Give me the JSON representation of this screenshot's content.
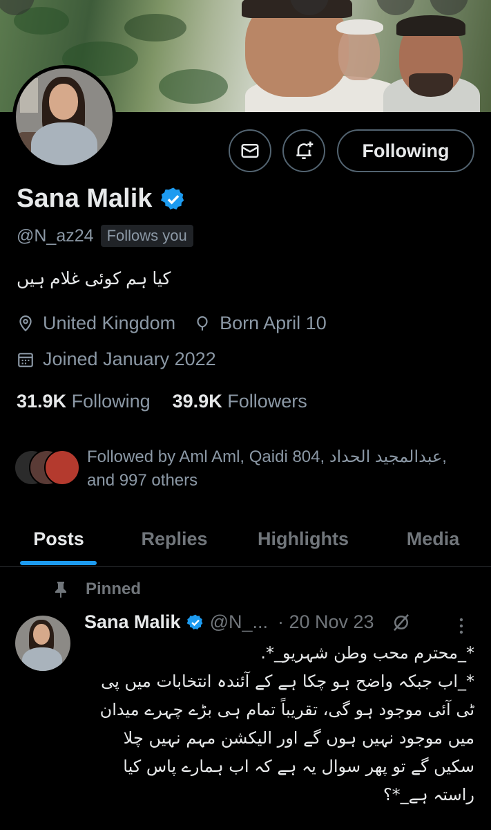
{
  "profile": {
    "name": "Sana Malik",
    "handle": "@N_az24",
    "follows_you": "Follows you",
    "bio": "کیا ہم کوئی غلام ہیں",
    "location": "United Kingdom",
    "born": "Born April 10",
    "joined": "Joined January 2022",
    "following_count": "31.9K",
    "following_label": "Following",
    "followers_count": "39.9K",
    "followers_label": "Followers",
    "followed_by_line1": "Followed by Aml Aml, Qaidi 804, عبدالمجيد الحداد,",
    "followed_by_line2": "and 997 others",
    "verified_icon": "verified-badge-icon"
  },
  "actions": {
    "following_button": "Following",
    "message_icon": "mail-icon",
    "notify_icon": "bell-plus-icon"
  },
  "tabs": [
    {
      "label": "Posts",
      "active": true
    },
    {
      "label": "Replies",
      "active": false
    },
    {
      "label": "Highlights",
      "active": false
    },
    {
      "label": "Media",
      "active": false
    }
  ],
  "pinned_post": {
    "pinned_label": "Pinned",
    "author": "Sana Malik",
    "handle": "@N_...",
    "date": "· 20 Nov 23",
    "text_lines": [
      "*_محترم محب وطن شہریو_*.",
      "*_اب جبکہ واضح ہو چکا ہے کے آئندہ انتخابات میں پی",
      "ٹی آئی موجود ہو گی، تقریباً تمام ہی بڑے چہرے میدان",
      "میں موجود نہیں ہوں گے اور الیکشن مہم نہیں چلا",
      "سکیں گے تو پھر سوال یہ ہے کہ اب ہمارے پاس کیا",
      "راستہ ہے_*؟"
    ]
  },
  "colors": {
    "accent": "#1d9bf0",
    "muted": "#71767b",
    "text": "#e7e9ea",
    "border": "#2f3336"
  }
}
